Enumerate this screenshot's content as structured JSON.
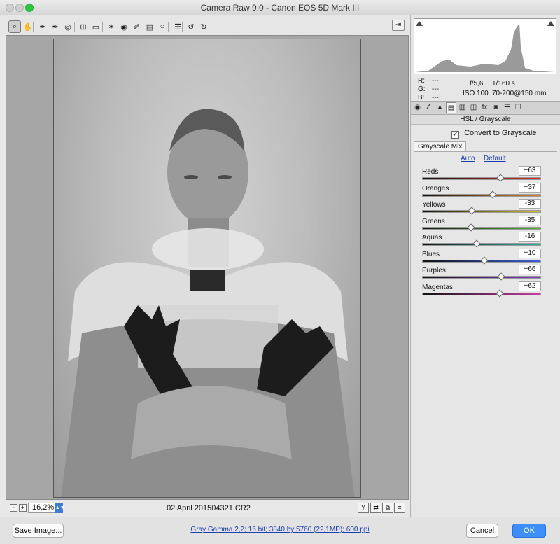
{
  "window": {
    "title": "Camera Raw 9.0  -  Canon EOS 5D Mark III"
  },
  "toolbar": {
    "tools": [
      {
        "icon": "zoom-icon",
        "glyph": "⌕",
        "active": true
      },
      {
        "icon": "hand-icon",
        "glyph": "✋"
      },
      {
        "icon": "white-balance-icon",
        "glyph": "✒"
      },
      {
        "icon": "color-sampler-icon",
        "glyph": "✒"
      },
      {
        "icon": "targeted-adjustment-icon",
        "glyph": "◎"
      },
      {
        "icon": "crop-icon",
        "glyph": "⊞"
      },
      {
        "icon": "straighten-icon",
        "glyph": "▭"
      },
      {
        "icon": "spot-removal-icon",
        "glyph": "✶"
      },
      {
        "icon": "red-eye-icon",
        "glyph": "◉"
      },
      {
        "icon": "adjustment-brush-icon",
        "glyph": "✐"
      },
      {
        "icon": "graduated-filter-icon",
        "glyph": "▤"
      },
      {
        "icon": "radial-filter-icon",
        "glyph": "○"
      },
      {
        "icon": "preferences-icon",
        "glyph": "☰"
      },
      {
        "icon": "rotate-left-icon",
        "glyph": "↺"
      },
      {
        "icon": "rotate-right-icon",
        "glyph": "↻"
      }
    ],
    "fullscreen_icon": "fullscreen-icon"
  },
  "preview": {
    "zoom_value": "16,2%",
    "filename": "02 April 201504321.CR2"
  },
  "readout": {
    "r": "R:",
    "r_val": "---",
    "g": "G:",
    "g_val": "---",
    "b": "B:",
    "b_val": "---",
    "aperture": "f/5,6",
    "shutter": "1/160 s",
    "iso": "ISO 100",
    "lens": "70-200@150 mm"
  },
  "panel": {
    "section_title": "HSL / Grayscale",
    "convert_label": "Convert to Grayscale",
    "convert_checked": true,
    "subtab": "Grayscale Mix",
    "auto_link": "Auto",
    "default_link": "Default",
    "sliders": [
      {
        "label": "Reds",
        "value": "+63",
        "amount": 63,
        "color": "#d9302a"
      },
      {
        "label": "Oranges",
        "value": "+37",
        "amount": 37,
        "color": "#e3862a"
      },
      {
        "label": "Yellows",
        "value": "-33",
        "amount": -33,
        "color": "#d8c728"
      },
      {
        "label": "Greens",
        "value": "-35",
        "amount": -35,
        "color": "#55b83a"
      },
      {
        "label": "Aquas",
        "value": "-16",
        "amount": -16,
        "color": "#2fb3a8"
      },
      {
        "label": "Blues",
        "value": "+10",
        "amount": 10,
        "color": "#3a5fd8"
      },
      {
        "label": "Purples",
        "value": "+66",
        "amount": 66,
        "color": "#8a3cc8"
      },
      {
        "label": "Magentas",
        "value": "+62",
        "amount": 62,
        "color": "#c83ca8"
      }
    ]
  },
  "bottom": {
    "save_label": "Save Image...",
    "workflow": "Gray Gamma 2,2; 16 bit; 3840 by 5760 (22,1MP); 600 ppi",
    "cancel_label": "Cancel",
    "ok_label": "OK"
  }
}
